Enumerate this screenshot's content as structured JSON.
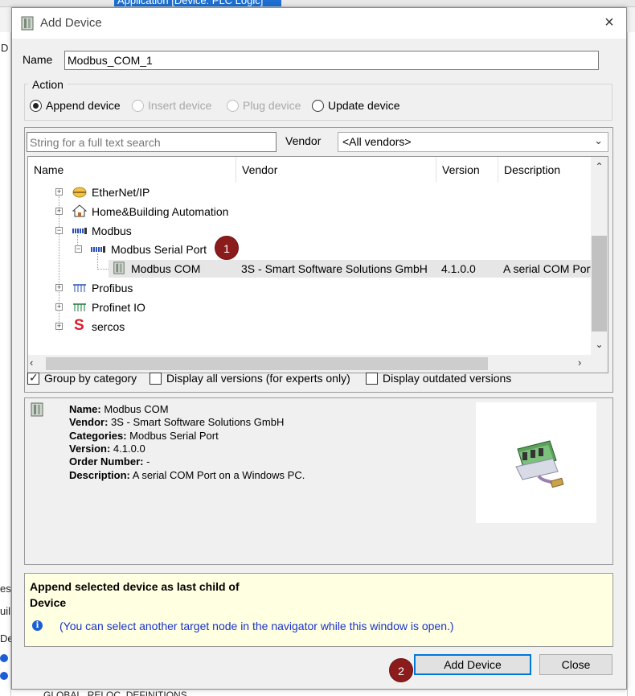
{
  "background": {
    "tab_title": "Application [Device: PLC Logic]",
    "fragments": [
      "D",
      "uil",
      "es",
      "Des",
      "GLOBAL_RELOC_DEFINITIONS"
    ]
  },
  "dialog": {
    "title": "Add Device",
    "close_label": "×",
    "name_label": "Name",
    "name_value": "Modbus_COM_1",
    "action_label": "Action",
    "actions": [
      {
        "label": "Append device",
        "selected": true,
        "enabled": true
      },
      {
        "label": "Insert device",
        "selected": false,
        "enabled": false
      },
      {
        "label": "Plug device",
        "selected": false,
        "enabled": false
      },
      {
        "label": "Update device",
        "selected": false,
        "enabled": true
      }
    ],
    "search_placeholder": "String for a full text search",
    "vendor_label": "Vendor",
    "vendor_value": "<All vendors>",
    "columns": [
      "Name",
      "Vendor",
      "Version",
      "Description"
    ],
    "tree": [
      {
        "name": "EtherNet/IP",
        "icon": "ethernet-ip-icon",
        "level": 0,
        "expander": "+"
      },
      {
        "name": "Home&Building Automation",
        "icon": "house-icon",
        "level": 0,
        "expander": "+"
      },
      {
        "name": "Modbus",
        "icon": "modbus-icon",
        "level": 0,
        "expander": "−"
      },
      {
        "name": "Modbus Serial Port",
        "icon": "modbus-icon",
        "level": 1,
        "expander": "−"
      },
      {
        "name": "Modbus COM",
        "icon": "device-icon",
        "level": 2,
        "vendor": "3S - Smart Software Solutions GmbH",
        "version": "4.1.0.0",
        "description": "A serial COM Port",
        "selected": true
      },
      {
        "name": "Profibus",
        "icon": "profibus-icon",
        "level": 0,
        "expander": "+"
      },
      {
        "name": "Profinet IO",
        "icon": "profinet-icon",
        "level": 0,
        "expander": "+"
      },
      {
        "name": "sercos",
        "icon": "sercos-icon",
        "level": 0,
        "expander": "+"
      }
    ],
    "checkboxes": [
      {
        "label": "Group by category",
        "checked": true
      },
      {
        "label": "Display all versions (for experts only)",
        "checked": false
      },
      {
        "label": "Display outdated versions",
        "checked": false
      }
    ],
    "info": {
      "name_key": "Name:",
      "name_val": "Modbus COM",
      "vendor_key": "Vendor:",
      "vendor_val": "3S - Smart Software Solutions GmbH",
      "categories_key": "Categories:",
      "categories_val": "Modbus Serial Port",
      "version_key": "Version:",
      "version_val": "4.1.0.0",
      "order_key": "Order Number:",
      "order_val": "-",
      "description_key": "Description:",
      "description_val": "A serial COM Port on a Windows PC."
    },
    "hint": {
      "line1": "Append selected device as last child of",
      "line2": "Device",
      "info_glyph": "i",
      "note": "(You can select another target node in the navigator while this window is open.)"
    },
    "buttons": {
      "add": "Add Device",
      "close": "Close"
    },
    "badges": [
      "1",
      "2"
    ]
  }
}
